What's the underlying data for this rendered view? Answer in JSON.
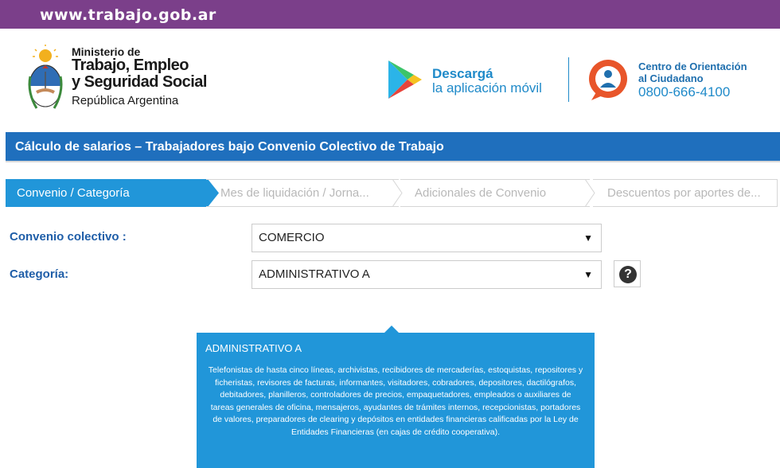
{
  "topbar": {
    "url": "www.trabajo.gob.ar"
  },
  "header": {
    "ministry_line1": "Ministerio de",
    "ministry_line2": "Trabajo, Empleo",
    "ministry_line3": "y Seguridad Social",
    "ministry_line4": "República Argentina",
    "app_line1": "Descargá",
    "app_line2": "la aplicación móvil",
    "coc_line1": "Centro de Orientación",
    "coc_line2": "al Ciudadano",
    "coc_phone": "0800-666-4100"
  },
  "page_title": "Cálculo de salarios – Trabajadores bajo Convenio Colectivo de Trabajo",
  "steps": [
    {
      "label": "Convenio / Categoría",
      "active": true
    },
    {
      "label": "Mes de liquidación / Jorna...",
      "active": false
    },
    {
      "label": "Adicionales de Convenio",
      "active": false
    },
    {
      "label": "Descuentos por aportes de...",
      "active": false
    }
  ],
  "form": {
    "convenio_label": "Convenio colectivo :",
    "convenio_value": "COMERCIO",
    "categoria_label": "Categoría:",
    "categoria_value": "ADMINISTRATIVO A",
    "caret": "▼",
    "help": "?"
  },
  "tooltip": {
    "title": "ADMINISTRATIVO A",
    "body": "Telefonistas de hasta cinco líneas, archivistas, recibidores de mercaderías, estoquistas, repositores y ficheristas, revisores de facturas, informantes, visitadores, cobradores, depositores, dactilógrafos, debitadores, planilleros, controladores de precios, empaquetadores, empleados o auxiliares de tareas generales de oficina, mensajeros, ayudantes de trámites internos, recepcionistas, portadores de valores, preparadores de clearing y depósitos en entidades financieras calificadas por la Ley de Entidades Financieras (en cajas de crédito cooperativa)."
  },
  "colors": {
    "topbar": "#7b3f8a",
    "title_bar": "#1f6fbd",
    "accent": "#2196d9",
    "label": "#1f5ea8",
    "coc_orange": "#e8552a"
  }
}
